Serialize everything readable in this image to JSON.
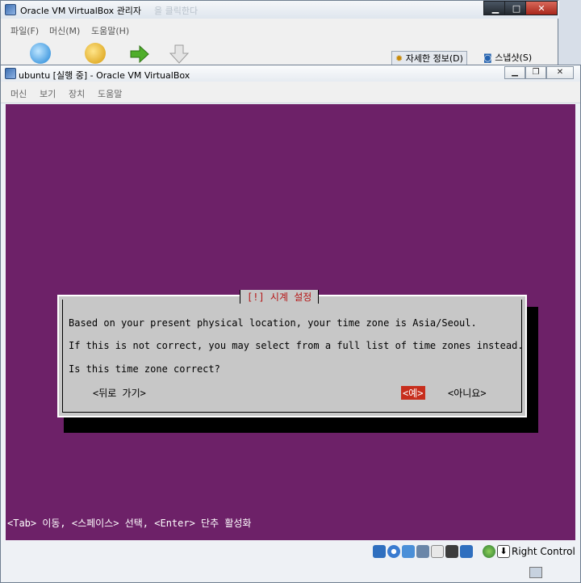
{
  "manager": {
    "title": "Oracle VM VirtualBox 관리자",
    "behind_text": "을 클릭한다",
    "menu": [
      "파일(F)",
      "머신(M)",
      "도움말(H)"
    ],
    "details_button": "자세한 정보(D)",
    "snapshot_button": "스냅샷(S)"
  },
  "vm": {
    "title": "ubuntu [실행 중] - Oracle VM VirtualBox",
    "menu": [
      "머신",
      "보기",
      "장치",
      "도움말"
    ]
  },
  "dialog": {
    "title": "[!] 시계 설정",
    "line1": "Based on your present physical location, your time zone is Asia/Seoul.",
    "line2": "If this is not correct, you may select from a full list of time zones instead.",
    "line3": "Is this time zone correct?",
    "back_button": "<뒤로 가기>",
    "yes_button": "<예>",
    "no_button": "<아니요>"
  },
  "hint": "<Tab> 이동, <스페이스> 선택, <Enter> 단추 활성화",
  "status": {
    "host_key": "Right Control"
  },
  "colors": {
    "screen_bg": "#6d2168",
    "dialog_bg": "#c7c7c7",
    "title_red": "#b51515",
    "selected_button": "#c72e1d"
  }
}
